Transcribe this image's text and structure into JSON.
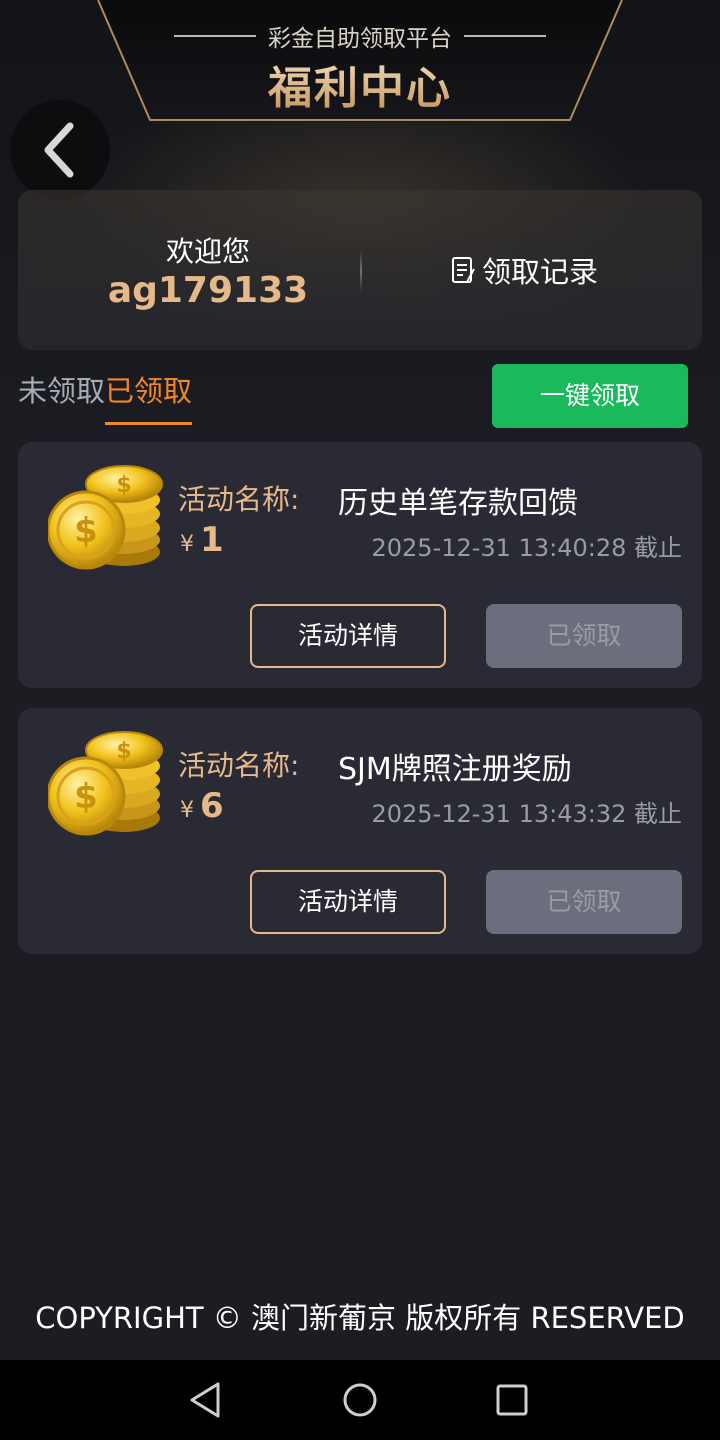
{
  "header": {
    "subtitle": "彩金自助领取平台",
    "title": "福利中心"
  },
  "user": {
    "welcome": "欢迎您",
    "username": "ag179133",
    "record_label": "领取记录"
  },
  "tabs": [
    {
      "label": "未领取",
      "active": false
    },
    {
      "label": "已领取",
      "active": true
    }
  ],
  "one_click_label": "一键领取",
  "activities": [
    {
      "label": "活动名称:",
      "name": "历史单笔存款回馈",
      "currency": "¥",
      "amount": "1",
      "deadline": "2025-12-31 13:40:28 截止",
      "detail_label": "活动详情",
      "status_label": "已领取"
    },
    {
      "label": "活动名称:",
      "name": "SJM牌照注册奖励",
      "currency": "¥",
      "amount": "6",
      "deadline": "2025-12-31 13:43:32 截止",
      "detail_label": "活动详情",
      "status_label": "已领取"
    }
  ],
  "footer": {
    "copyright": "COPYRIGHT © 澳门新葡京 版权所有 RESERVED"
  },
  "colors": {
    "accent_gold": "#e6b98a",
    "active_tab": "#f0862a",
    "green_button": "#1aba5c",
    "disabled_button": "#6b6e7d"
  },
  "icons": [
    "back-arrow-icon",
    "document-icon",
    "gold-coins-icon",
    "nav-back-icon",
    "nav-home-icon",
    "nav-recents-icon"
  ]
}
